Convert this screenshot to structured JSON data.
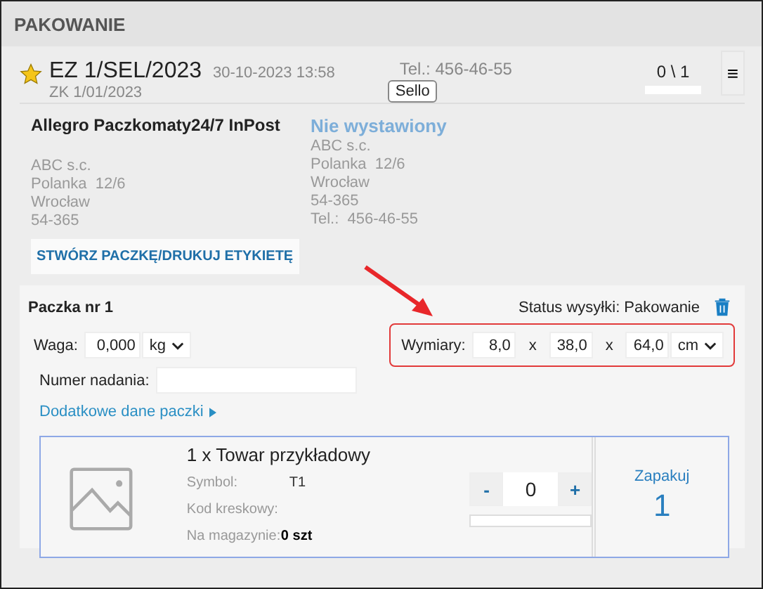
{
  "title": "PAKOWANIE",
  "order": {
    "starred": true,
    "number": "EZ 1/SEL/2023",
    "date": "30-10-2023 13:58",
    "ref": "ZK 1/01/2023",
    "phone": "Tel.: 456-46-55",
    "channel_badge": "Sello",
    "count": "0 \\ 1",
    "menu_icon": "≡"
  },
  "shipping": {
    "carrier": "Allegro Paczkomaty24/7 InPost",
    "address": [
      "ABC s.c.",
      "Polanka  12/6",
      "Wrocław",
      "54-365"
    ]
  },
  "invoice": {
    "status": "Nie wystawiony",
    "address": [
      "ABC s.c.",
      "Polanka  12/6",
      "Wrocław",
      "54-365",
      "Tel.:  456-46-55"
    ]
  },
  "create_button": "STWÓRZ PACZKĘ/DRUKUJ ETYKIETĘ",
  "package": {
    "title": "Paczka nr 1",
    "status": "Status wysyłki: Pakowanie",
    "weight": {
      "label": "Waga:",
      "value": "0,000",
      "unit": "kg"
    },
    "dimensions": {
      "label": "Wymiary:",
      "values": [
        "8,0",
        "38,0",
        "64,0"
      ],
      "separators": [
        "x",
        "x"
      ],
      "unit": "cm",
      "highlighted": true
    },
    "tracking_label": "Numer nadania:",
    "more_link": "Dodatkowe dane paczki"
  },
  "items": [
    {
      "title": "1 x Towar przykładowy",
      "fields": [
        {
          "label": "Symbol:",
          "value": "T1",
          "bold": false
        },
        {
          "label": "Kod kreskowy:"
        },
        {
          "label": "Na magazynie:",
          "value": "0 szt",
          "bold": true
        }
      ],
      "minus": "-",
      "quantity": "0",
      "plus": "+",
      "level": 0,
      "pack_label": "Zapakuj",
      "pack_count": "1"
    }
  ]
}
